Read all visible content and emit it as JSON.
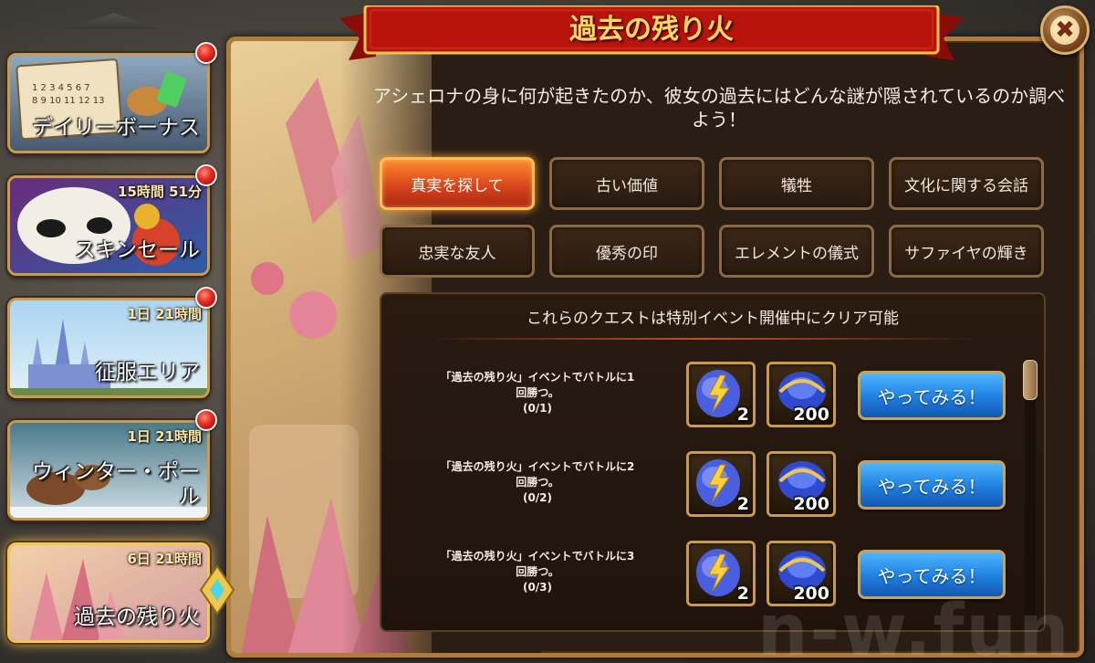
{
  "title": "過去の残り火",
  "description": "アシェロナの身に何が起きたのか、彼女の過去にはどんな謎が隠されているのか調べよう！",
  "sidebar": {
    "items": [
      {
        "label": "デイリーボーナス",
        "timer": ""
      },
      {
        "label": "スキンセール",
        "timer": "15時間 51分"
      },
      {
        "label": "征服エリア",
        "timer": "1日 21時間"
      },
      {
        "label": "ウィンター・ポール",
        "timer": "1日 21時間"
      },
      {
        "label": "過去の残り火",
        "timer": "6日 21時間"
      }
    ]
  },
  "tabs": [
    {
      "label": "真実を探して",
      "active": true
    },
    {
      "label": "古い価値"
    },
    {
      "label": "犠牲"
    },
    {
      "label": "文化に関する会話"
    },
    {
      "label": "忠実な友人"
    },
    {
      "label": "優秀の印"
    },
    {
      "label": "エレメントの儀式"
    },
    {
      "label": "サファイヤの輝き"
    }
  ],
  "quest_header": "これらのクエストは特別イベント開催中にクリア可能",
  "quests": [
    {
      "line1": "「過去の残り火」イベントでバトルに1",
      "line2": "回勝つ。",
      "progress": "(0/1)",
      "reward1": "2",
      "reward2": "200",
      "button": "やってみる！"
    },
    {
      "line1": "「過去の残り火」イベントでバトルに2",
      "line2": "回勝つ。",
      "progress": "(0/2)",
      "reward1": "2",
      "reward2": "200",
      "button": "やってみる！"
    },
    {
      "line1": "「過去の残り火」イベントでバトルに3",
      "line2": "回勝つ。",
      "progress": "(0/3)",
      "reward1": "2",
      "reward2": "200",
      "button": "やってみる！"
    }
  ],
  "close_label": "✖",
  "watermark": "n-w.fun",
  "colors": {
    "accent": "#ffd964",
    "banner": "#b8140c",
    "button": "#1f7fe0",
    "active_tab": "#d9451c",
    "frame": "#b07c3a"
  }
}
